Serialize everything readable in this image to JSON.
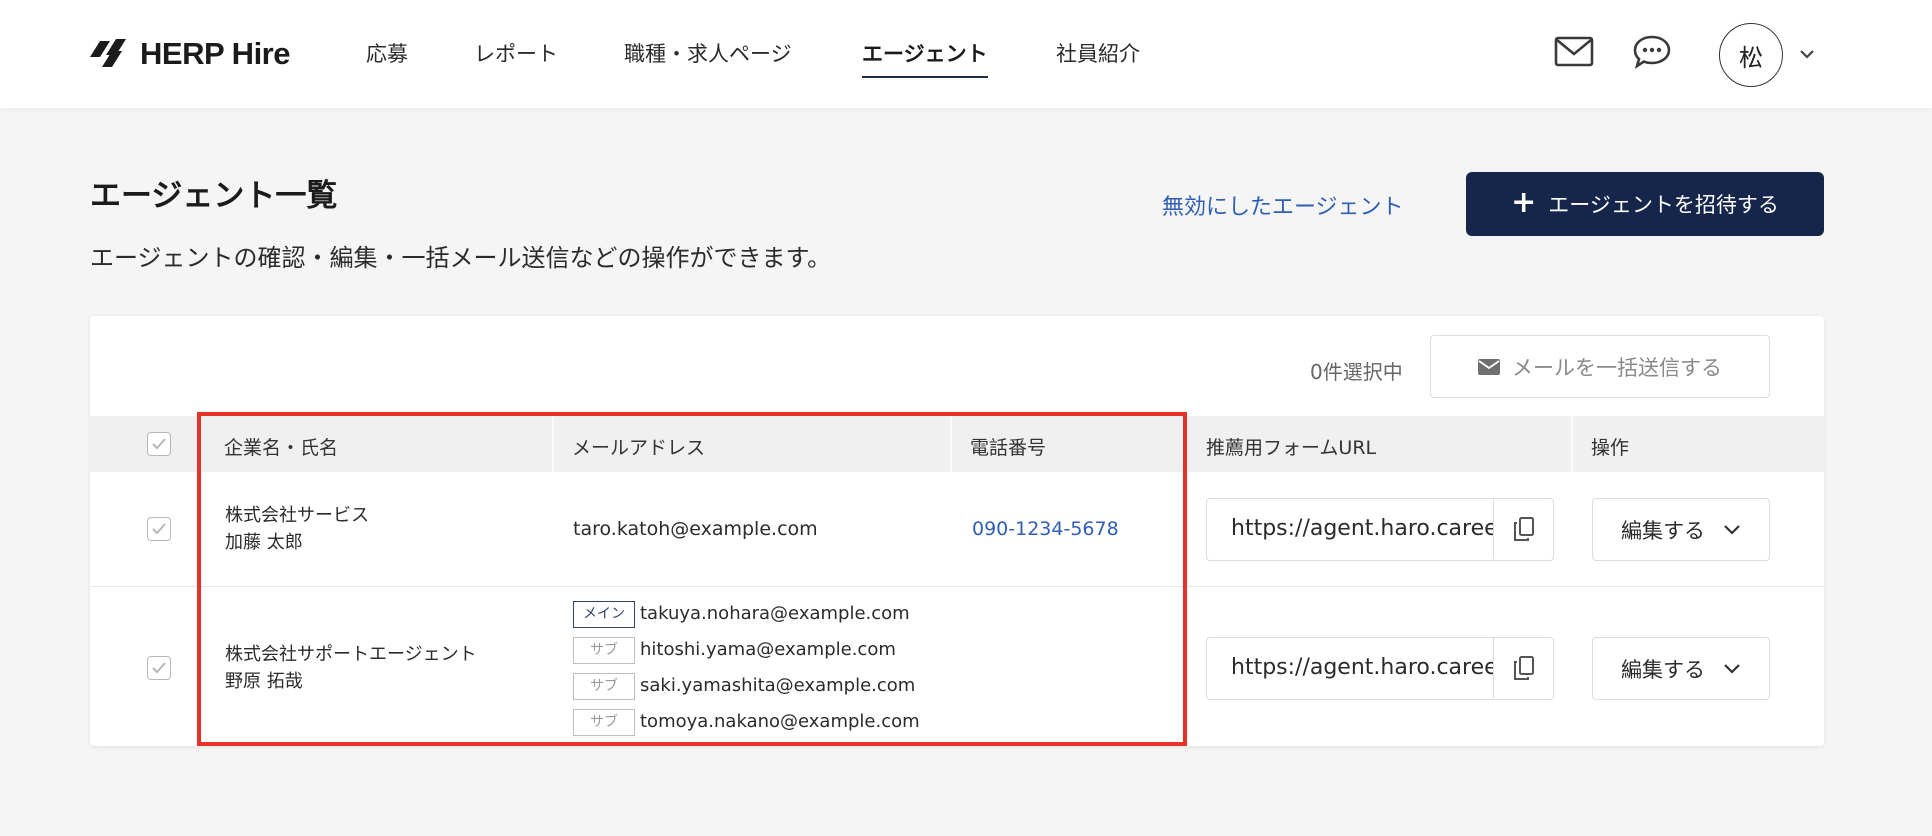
{
  "header": {
    "brand": "HERP Hire",
    "nav": [
      {
        "label": "応募"
      },
      {
        "label": "レポート"
      },
      {
        "label": "職種・求人ページ"
      },
      {
        "label": "エージェント"
      },
      {
        "label": "社員紹介"
      }
    ],
    "active_nav": "エージェント",
    "avatar_initial": "松"
  },
  "page": {
    "title": "エージェント一覧",
    "description": "エージェントの確認・編集・一括メール送信などの操作ができます。",
    "disabled_agents_link": "無効にしたエージェント",
    "invite_button": "エージェントを招待する"
  },
  "toolbar": {
    "selected_count": "0件選択中",
    "bulk_mail_button": "メールを一括送信する"
  },
  "table": {
    "columns": [
      "企業名・氏名",
      "メールアドレス",
      "電話番号",
      "推薦用フォームURL",
      "操作"
    ],
    "rows": [
      {
        "company": "株式会社サービス",
        "name": "加藤 太郎",
        "email": "taro.katoh@example.com",
        "phone": "090-1234-5678",
        "form_url": "https://agent.haro.careers",
        "action": "編集する"
      },
      {
        "company": "株式会社サポートエージェント",
        "name": "野原 拓哉",
        "emails": [
          {
            "badge": "メイン",
            "address": "takuya.nohara@example.com"
          },
          {
            "badge": "サブ",
            "address": "hitoshi.yama@example.com"
          },
          {
            "badge": "サブ",
            "address": "saki.yamashita@example.com"
          },
          {
            "badge": "サブ",
            "address": "tomoya.nakano@example.com"
          }
        ],
        "phone": "",
        "form_url": "https://agent.haro.careers",
        "action": "編集する"
      }
    ]
  },
  "colors": {
    "primary": "#16264a",
    "link": "#2f5fb4",
    "highlight": "#e53325",
    "background": "#f5f5f5"
  }
}
